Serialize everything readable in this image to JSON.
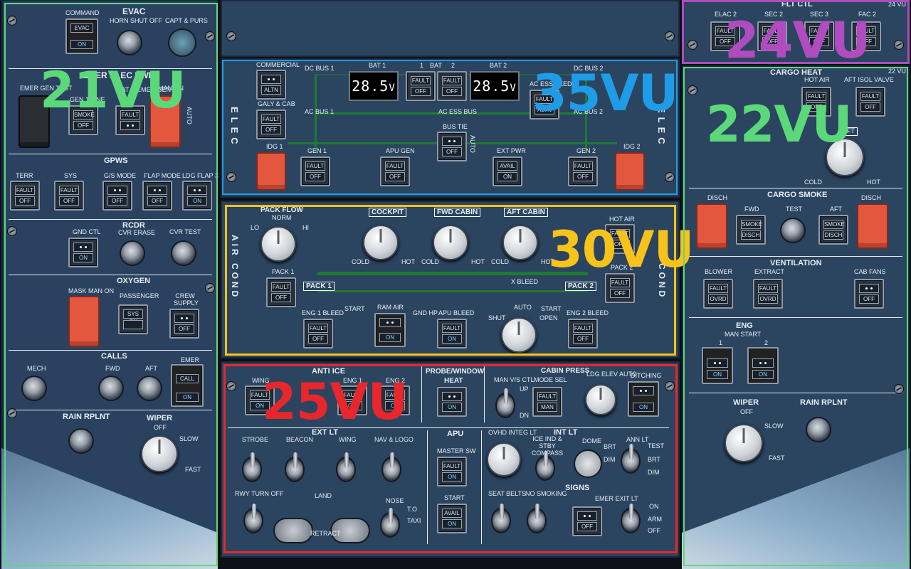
{
  "highlights": [
    {
      "label": "21VU",
      "color": "#5bd97a"
    },
    {
      "label": "35VU",
      "color": "#1f9ce8"
    },
    {
      "label": "30VU",
      "color": "#f7c31a"
    },
    {
      "label": "25VU",
      "color": "#e8272d"
    },
    {
      "label": "24VU",
      "color": "#b04bc0"
    },
    {
      "label": "22VU",
      "color": "#5bd97a"
    }
  ],
  "left": {
    "command": "COMMAND",
    "evac": "EVAC",
    "horn": "HORN SHUT OFF",
    "capt": "CAPT & PURS",
    "evac_btn_top": "EVAC",
    "evac_btn_bot": "ON",
    "emer_elec_pwr": "EMER ELEC PWR",
    "emer_gen_test": "EMER GEN TEST",
    "gen_line": "GEN 1 LINE",
    "rat": "RAT & EMER GEN",
    "man_on": "MAN ON",
    "auto": "AUTO",
    "smoke": "SMOKE",
    "off": "OFF",
    "fault": "FAULT",
    "gpws": "GPWS",
    "terr": "TERR",
    "sys": "SYS",
    "gs": "G/S MODE",
    "flap": "FLAP MODE",
    "ldg": "LDG FLAP 3",
    "on": "ON",
    "rcdr": "RCDR",
    "gnd": "GND CTL",
    "cvr_erase": "CVR ERASE",
    "cvr_test": "CVR TEST",
    "oxygen": "OXYGEN",
    "mask": "MASK MAN ON",
    "passenger": "PASSENGER",
    "sys_on": "SYS ON",
    "crew": "CREW SUPPLY",
    "calls": "CALLS",
    "mech": "MECH",
    "fwd": "FWD",
    "aft": "AFT",
    "emer": "EMER",
    "call": "CALL",
    "rain": "RAIN RPLNT",
    "wiper": "WIPER",
    "w_off": "OFF",
    "w_slow": "SLOW",
    "w_fast": "FAST"
  },
  "elec": {
    "title": "ELEC",
    "commercial": "COMMERCIAL",
    "galy": "GALY & CAB",
    "idg1": "IDG 1",
    "idg2": "IDG 2",
    "dc1": "DC BUS 1",
    "dc2": "DC BUS 2",
    "ac1": "AC BUS 1",
    "ac2": "AC BUS 2",
    "acess": "AC ESS BUS",
    "acessfeed": "AC ESS FEED",
    "bat1": "BAT 1",
    "bat2": "BAT 2",
    "bat": "BAT",
    "one": "1",
    "two": "2",
    "v1": "28.5",
    "v2": "28.5",
    "unit": "V",
    "bustie": "BUS TIE",
    "gen1": "GEN 1",
    "gen2": "GEN 2",
    "apugen": "APU GEN",
    "extpwr": "EXT PWR",
    "avail": "AVAIL",
    "altn": "ALTN"
  },
  "aircond": {
    "title": "AIR COND",
    "packflow": "PACK FLOW",
    "norm": "NORM",
    "lo": "LO",
    "hi": "HI",
    "cockpit": "COCKPIT",
    "fwdcabin": "FWD CABIN",
    "aftcabin": "AFT CABIN",
    "cold": "COLD",
    "hot": "HOT",
    "hotair": "HOT AIR",
    "pack1": "PACK 1",
    "pack2": "PACK 2",
    "xbleed": "X BLEED",
    "start": "START",
    "eng1": "ENG 1 BLEED",
    "ramair": "RAM AIR",
    "gndhp": "GND HP",
    "apubleed": "APU BLEED",
    "eng2": "ENG 2 BLEED",
    "shut": "SHUT",
    "auto": "AUTO",
    "open": "OPEN"
  },
  "lower": {
    "antiice": "ANTI ICE",
    "wing": "WING",
    "eng1": "ENG 1",
    "eng2": "ENG 2",
    "probe": "PROBE/WINDOW",
    "heat": "HEAT",
    "cabinpress": "CABIN PRESS",
    "manvs": "MAN V/S CTL",
    "up": "UP",
    "dn": "DN",
    "modesel": "MODE SEL",
    "man": "MAN",
    "ldgelev": "LDG ELEV AUTO",
    "ditching": "DITCHING",
    "extlt": "EXT LT",
    "strobe": "STROBE",
    "beacon": "BEACON",
    "wing_lt": "WING",
    "navlogo": "NAV & LOGO",
    "rwy": "RWY TURN OFF",
    "land": "LAND",
    "nose": "NOSE",
    "to": "T.O",
    "taxi": "TAXI",
    "retract": "RETRACT",
    "apu": "APU",
    "mastersw": "MASTER SW",
    "start": "START",
    "intlt": "INT LT",
    "ovhd": "OVHD INTEG LT",
    "iceind": "ICE IND & STBY COMPASS",
    "dome": "DOME",
    "annlt": "ANN LT",
    "test": "TEST",
    "brt": "BRT",
    "dim": "DIM",
    "signs": "SIGNS",
    "seatbelts": "SEAT BELTS",
    "nosmoking": "NO SMOKING",
    "emerexit": "EMER EXIT LT",
    "arm": "ARM",
    "vu": "25 VU"
  },
  "fltctl": {
    "title": "FLT CTL",
    "elac2": "ELAC 2",
    "sec2": "SEC 2",
    "sec3": "SEC 3",
    "fac2": "FAC 2",
    "vu": "24 VU"
  },
  "right": {
    "cargoheat": "CARGO HEAT",
    "hotair": "HOT AIR",
    "aftisol": "AFT ISOL VALVE",
    "aft": "AFT",
    "cold": "COLD",
    "hot": "HOT",
    "cargosmoke": "CARGO SMOKE",
    "disch": "DISCH",
    "fwd": "FWD",
    "test": "TEST",
    "smoke": "SMOKE",
    "ventilation": "VENTILATION",
    "blower": "BLOWER",
    "extract": "EXTRACT",
    "cabfans": "CAB FANS",
    "ovrd": "OVRD",
    "eng": "ENG",
    "manstart": "MAN START",
    "wiper": "WIPER",
    "rain": "RAIN RPLNT",
    "vu": "22 VU"
  }
}
